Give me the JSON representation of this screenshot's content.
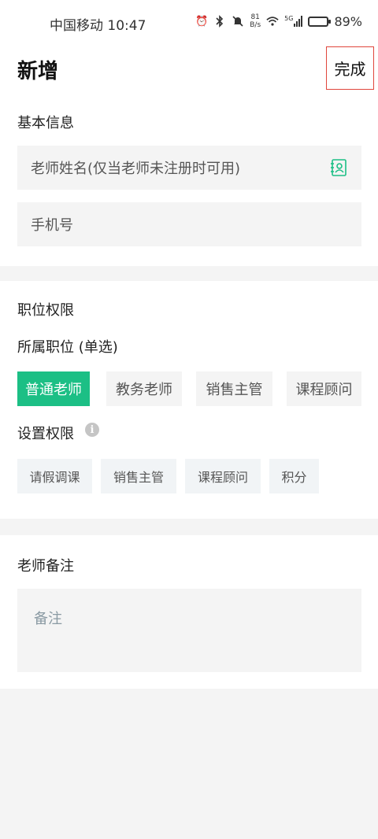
{
  "status_bar": {
    "carrier_time": "中国移动 10:47",
    "net_speed_value": "81",
    "net_speed_unit": "B/s",
    "network_type": "5G",
    "battery_percent": "89%",
    "battery_level": 0.89
  },
  "header": {
    "title": "新增",
    "done_label": "完成"
  },
  "basic_info": {
    "title": "基本信息",
    "teacher_name_placeholder": "老师姓名(仅当老师未注册时可用)",
    "phone_placeholder": "手机号"
  },
  "position": {
    "title": "职位权限",
    "role_label": "所属职位 (单选)",
    "roles": [
      "普通老师",
      "教务老师",
      "销售主管",
      "课程顾问"
    ],
    "selected_role": "普通老师",
    "permission_label": "设置权限",
    "permissions": [
      "请假调课",
      "销售主管",
      "课程顾问",
      "积分"
    ]
  },
  "notes": {
    "title": "老师备注",
    "placeholder": "备注"
  },
  "colors": {
    "accent": "#1cbf85",
    "highlight_border": "#e0463c"
  }
}
